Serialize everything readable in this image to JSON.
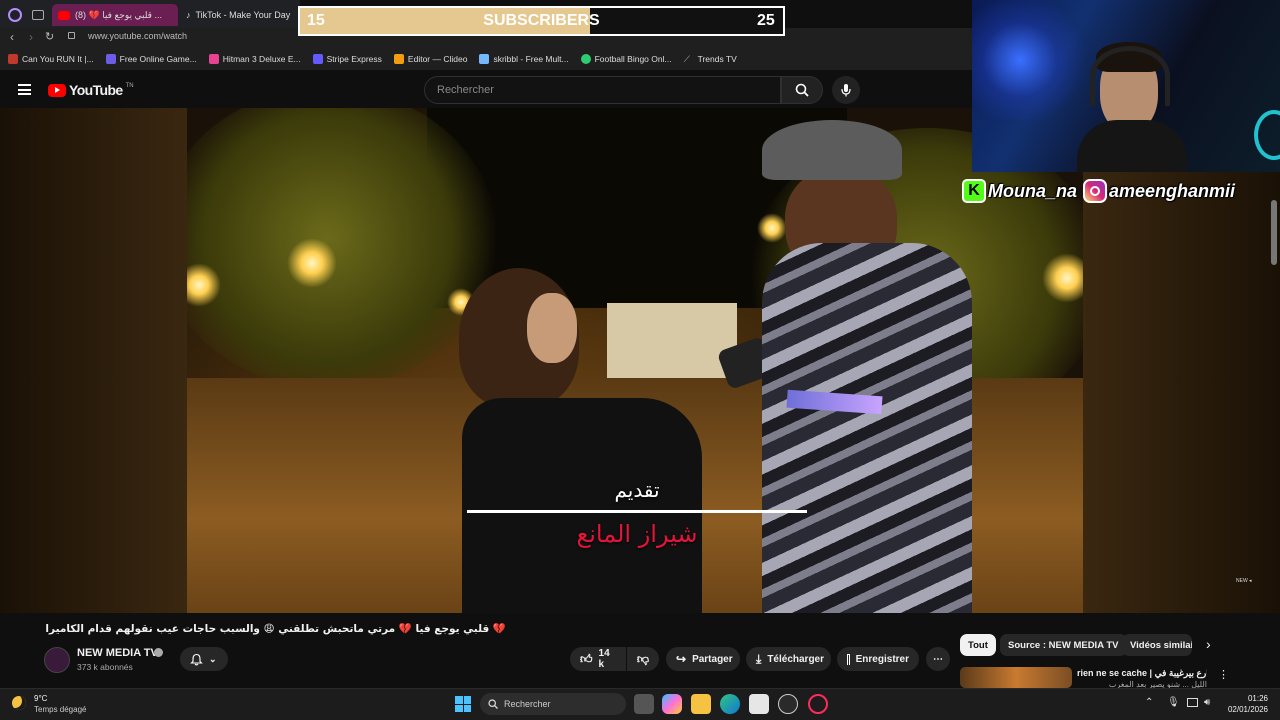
{
  "browser": {
    "tabs": [
      {
        "label": "(8) 💔 قلبي يوجع فيا ...",
        "active": true
      },
      {
        "label": "TikTok - Make Your Day",
        "active": false
      }
    ],
    "url": "www.youtube.com/watch",
    "bookmarks": [
      {
        "label": "Can You RUN It |...",
        "color": "#c0392b"
      },
      {
        "label": "Free Online Game...",
        "color": "#6c5ce7"
      },
      {
        "label": "Hitman 3 Deluxe E...",
        "color": "#e84393"
      },
      {
        "label": "Stripe Express",
        "color": "#635bff"
      },
      {
        "label": "Editor — Clideo",
        "color": "#f39c12"
      },
      {
        "label": "skribbl - Free Mult...",
        "color": "#74b9ff"
      },
      {
        "label": "Football Bingo Onl...",
        "color": "#2ecc71"
      },
      {
        "label": "Trends TV",
        "color": "#aaaaaa"
      }
    ]
  },
  "youtube": {
    "logo": "YouTube",
    "logo_sup": "TN",
    "search_placeholder": "Rechercher"
  },
  "overlay": {
    "sub_left": "15",
    "sub_label": "SUBSCRIBERS",
    "sub_right": "25",
    "sub_progress": 0.6,
    "kick_handle": "Mouna_na",
    "insta_handle": "ameenghanmii"
  },
  "video": {
    "caption_top": "تقديم",
    "caption_bottom": "شيراز المانع",
    "watermark": "NEW ◂"
  },
  "meta": {
    "title": "💔 قلبي يوجع فيا 💔 مرتي ماتحبش تطلقني 😩 والسبب حاجات عيب نقولهم قدام الكاميرا 🆕 📽️",
    "channel": "NEW MEDIA TV",
    "subscribers": "373 k abonnés",
    "likes": "14 k",
    "share": "Partager",
    "download": "Télécharger",
    "save": "Enregistrer"
  },
  "chips": [
    "Tout",
    "Source : NEW MEDIA TV",
    "Vidéos similai"
  ],
  "suggested": {
    "title": "rien ne se cache | شارع بيرغيبة في",
    "subtitle": "الليل ... شنو يصير بعد المغرب"
  },
  "taskbar": {
    "temp": "9°C",
    "weather": "Temps dégagé",
    "search": "Rechercher",
    "time": "01:26",
    "date": "02/01/2026"
  }
}
